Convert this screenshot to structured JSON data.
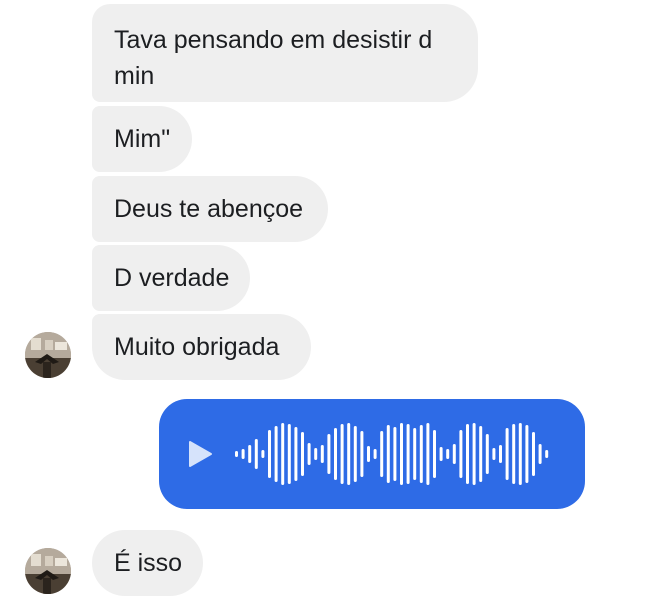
{
  "messages": [
    {
      "text": "Tava pensando em desistir d min"
    },
    {
      "text": "Mim\""
    },
    {
      "text": "Deus te abençoe"
    },
    {
      "text": "D verdade"
    },
    {
      "text": "Muito obrigada"
    },
    {
      "text": "É isso"
    }
  ],
  "voice_message": {
    "icon": "play-icon",
    "color": "#2e6be6"
  },
  "colors": {
    "incoming_bubble": "#efefef",
    "text": "#1c1e21",
    "outgoing_bubble": "#2e6be6"
  }
}
